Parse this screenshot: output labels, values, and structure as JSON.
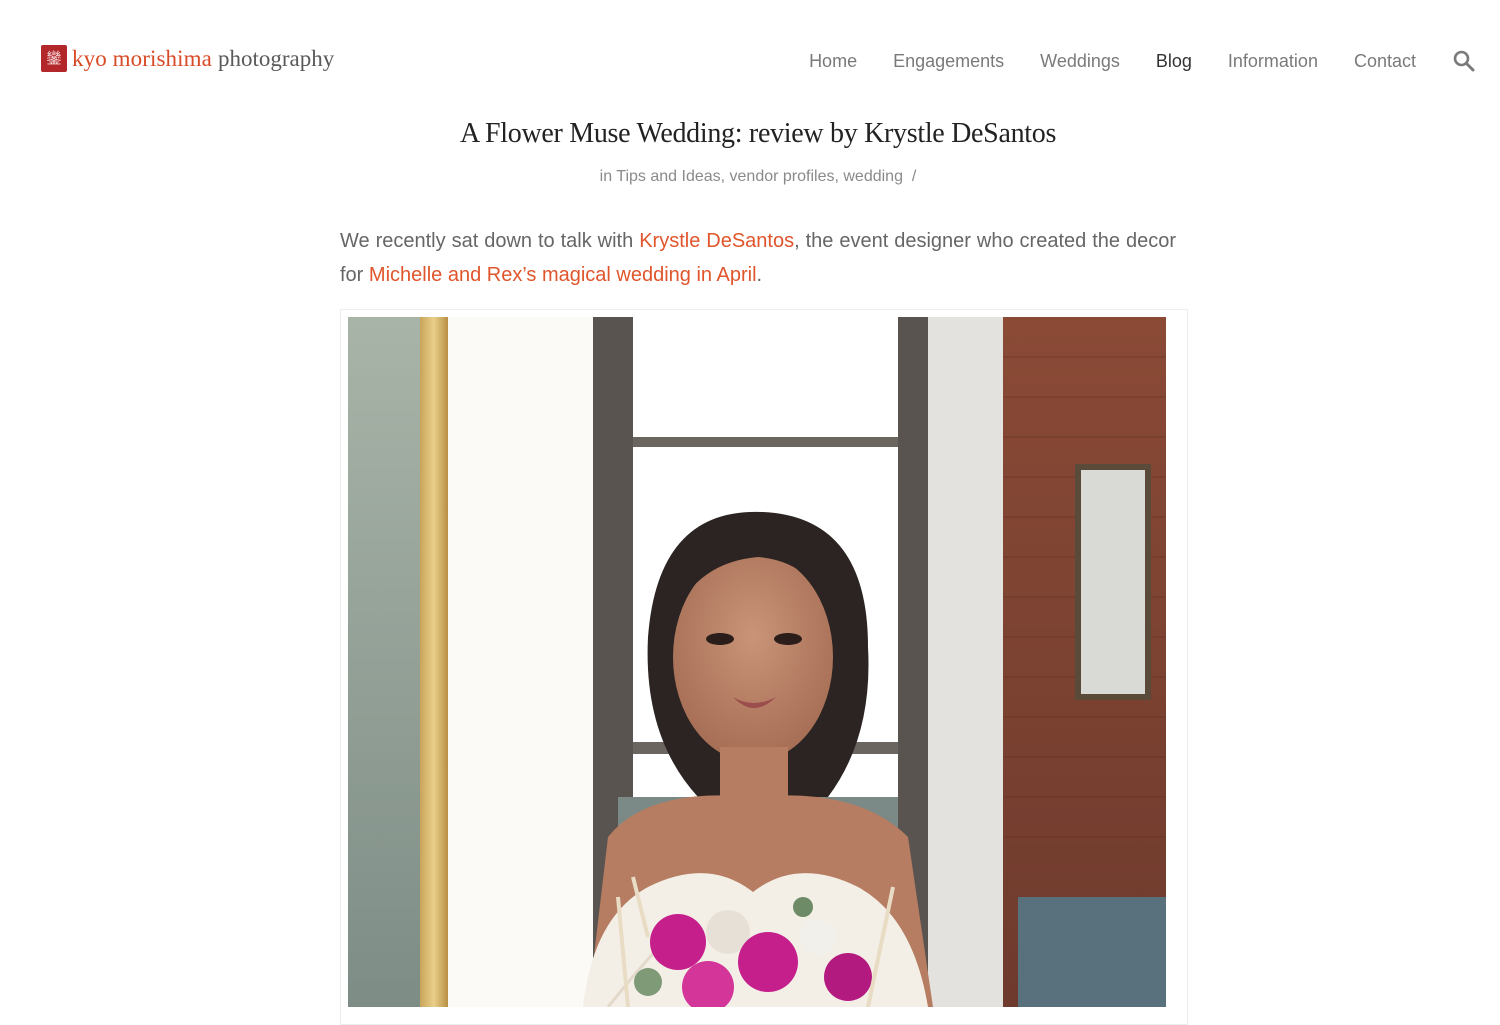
{
  "header": {
    "logo": {
      "mark_glyph": "鑾",
      "name": "kyo morishima",
      "suffix": "photography"
    },
    "nav": [
      {
        "label": "Home",
        "active": false
      },
      {
        "label": "Engagements",
        "active": false
      },
      {
        "label": "Weddings",
        "active": false
      },
      {
        "label": "Blog",
        "active": true
      },
      {
        "label": "Information",
        "active": false
      },
      {
        "label": "Contact",
        "active": false
      }
    ],
    "search_icon": "search-icon"
  },
  "post": {
    "title": "A Flower Muse Wedding: review by Krystle DeSantos",
    "meta": {
      "prefix": "in",
      "categories": [
        "Tips and Ideas",
        "vendor profiles",
        "wedding"
      ],
      "separator": "/"
    },
    "intro": {
      "part1": "We recently sat down to talk with ",
      "link1": "Krystle DeSantos",
      "part2": ", the event designer who created the decor for ",
      "link2": "Michelle and Rex’s magical wedding in April",
      "part3": "."
    }
  },
  "colors": {
    "accent": "#e0552b",
    "logo_red": "#b3262a",
    "text": "#666666",
    "nav_text": "#7a7a7a",
    "nav_active": "#333333"
  }
}
